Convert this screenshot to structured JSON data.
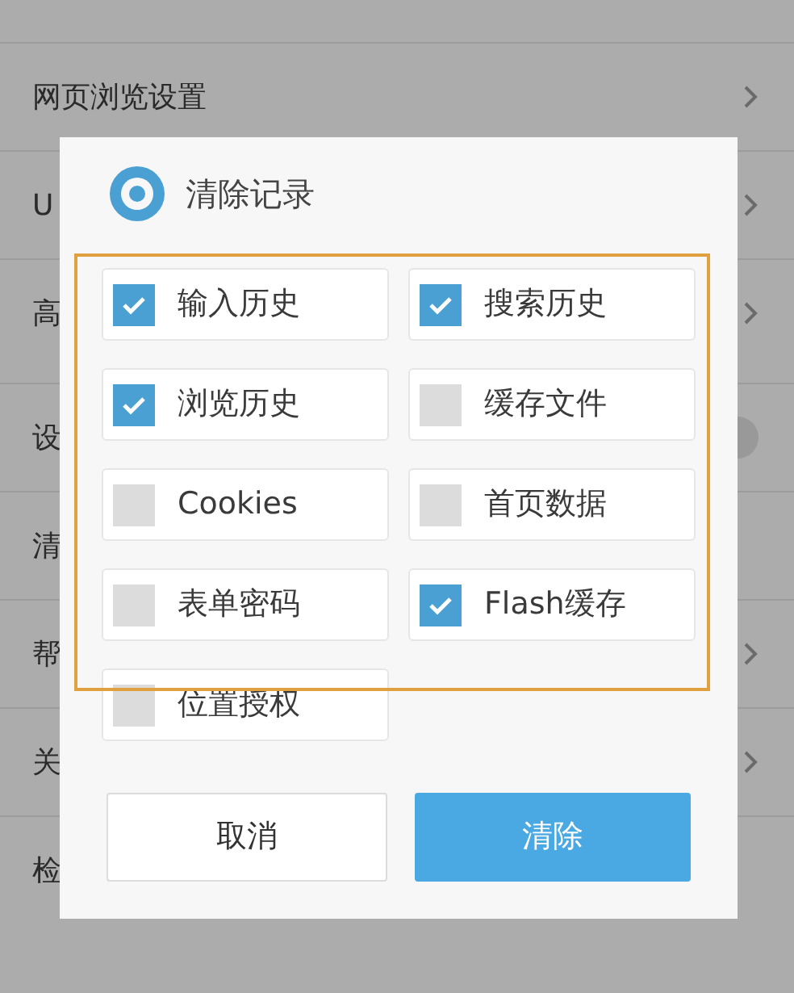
{
  "settings": [
    {
      "label": "网页浏览设置",
      "kind": "chevron"
    },
    {
      "label": "U",
      "kind": "chevron"
    },
    {
      "label": "高",
      "kind": "chevron"
    },
    {
      "label": "设",
      "kind": "switch",
      "on": false
    },
    {
      "label": "清",
      "kind": "plain"
    },
    {
      "label": "帮",
      "kind": "chevron"
    },
    {
      "label": "关",
      "kind": "chevron"
    },
    {
      "label": "检",
      "kind": "plain"
    }
  ],
  "dialog": {
    "title": "清除记录",
    "options": [
      {
        "label": "输入历史",
        "checked": true
      },
      {
        "label": "搜索历史",
        "checked": true
      },
      {
        "label": "浏览历史",
        "checked": true
      },
      {
        "label": "缓存文件",
        "checked": false
      },
      {
        "label": "Cookies",
        "checked": false
      },
      {
        "label": "首页数据",
        "checked": false
      },
      {
        "label": "表单密码",
        "checked": false
      },
      {
        "label": "Flash缓存",
        "checked": true
      },
      {
        "label": "位置授权",
        "checked": false
      }
    ],
    "buttons": [
      {
        "label": "取消",
        "kind": "secondary"
      },
      {
        "label": "清除",
        "kind": "primary"
      }
    ]
  }
}
